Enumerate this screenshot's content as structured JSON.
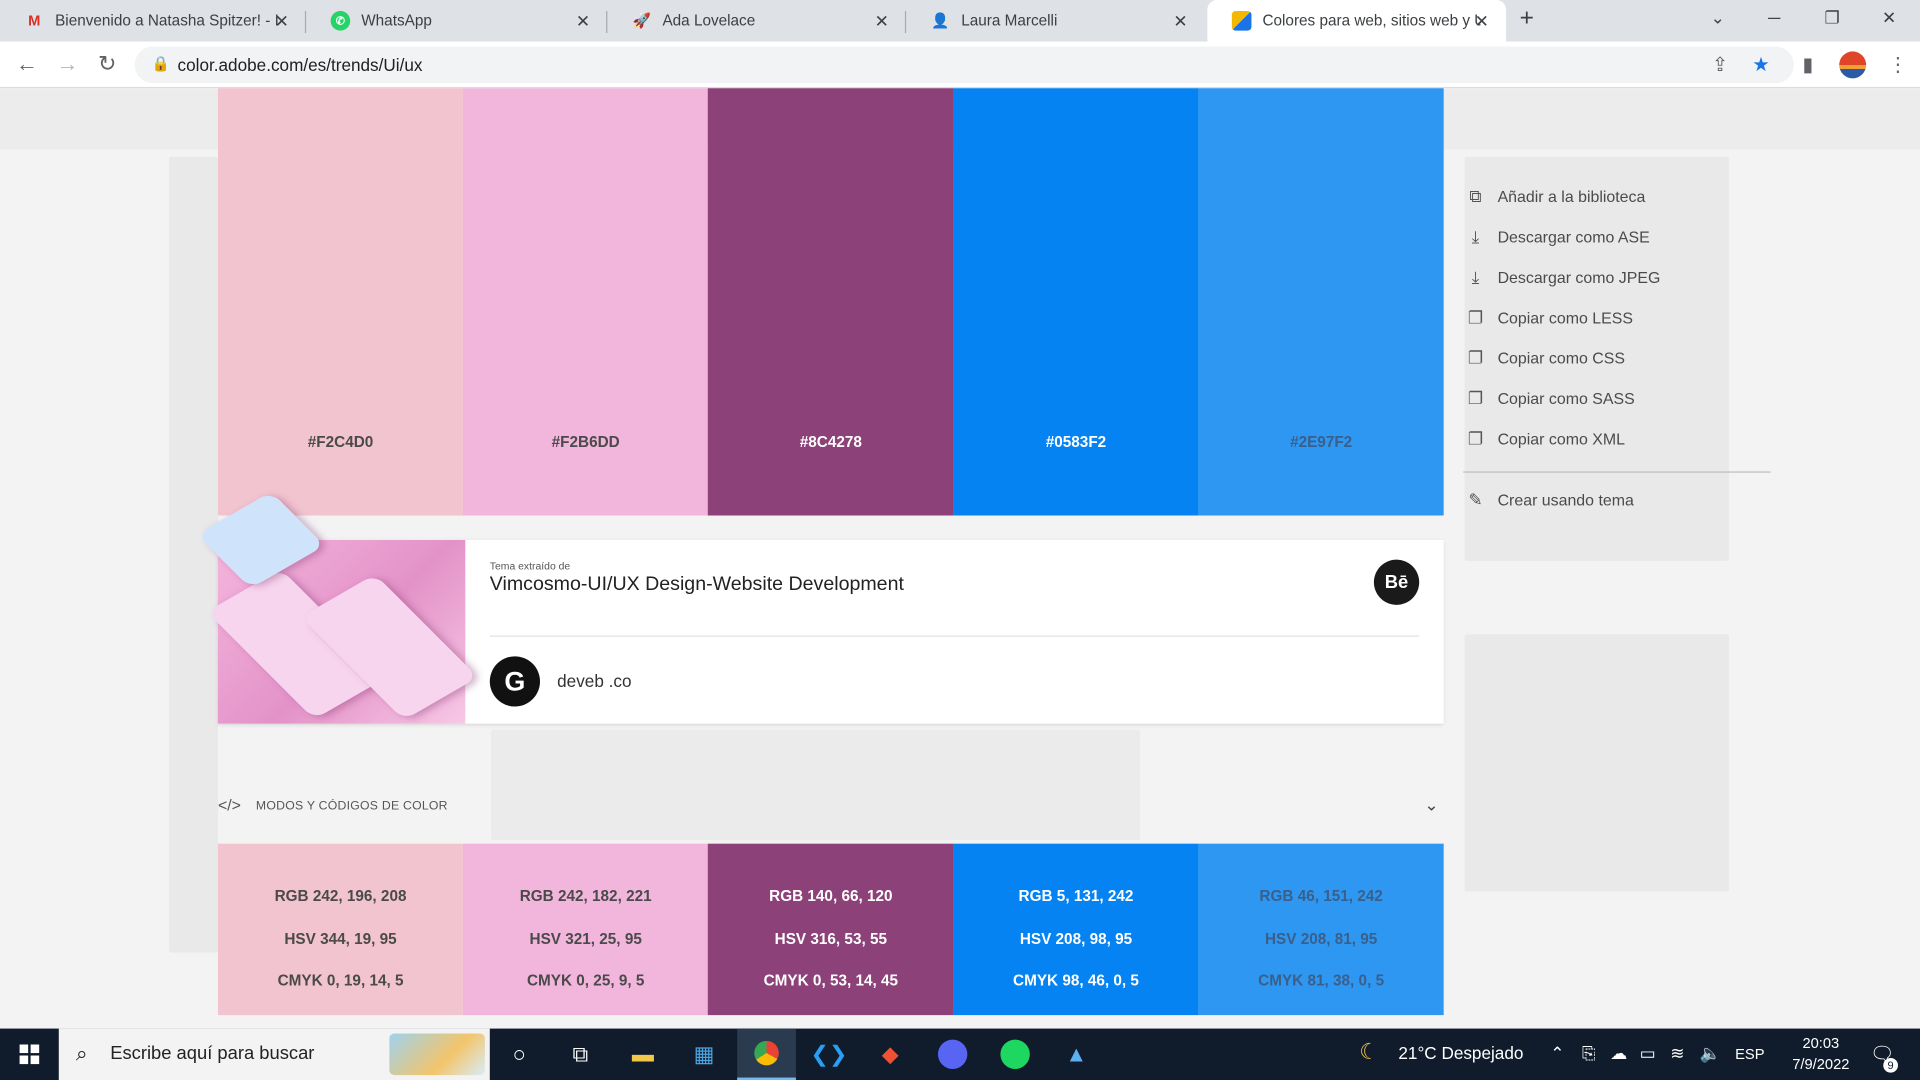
{
  "browser": {
    "tabs": [
      {
        "title": "Bienvenido a Natasha Spitzer! - I",
        "icon": "gmail-icon",
        "active": false
      },
      {
        "title": "WhatsApp",
        "icon": "whatsapp-icon",
        "active": false
      },
      {
        "title": "Ada Lovelace",
        "icon": "rocket-icon",
        "active": false
      },
      {
        "title": "Laura Marcelli",
        "icon": "profile-icon",
        "active": false
      },
      {
        "title": "Colores para web, sitios web y UI",
        "icon": "adobe-color-icon",
        "active": true
      }
    ],
    "url": "color.adobe.com/es/trends/Ui/ux"
  },
  "palette": {
    "swatches": [
      {
        "hex": "#F2C4D0",
        "color": "#F2C4D0",
        "text_color": "#4a4a4a"
      },
      {
        "hex": "#F2B6DD",
        "color": "#F2B6DD",
        "text_color": "#4a4a4a"
      },
      {
        "hex": "#8C4278",
        "color": "#8C4278",
        "text_color": "#ffffff"
      },
      {
        "hex": "#0583F2",
        "color": "#0583F2",
        "text_color": "#ffffff"
      },
      {
        "hex": "#2E97F2",
        "color": "#2E97F2",
        "text_color": "#3a5f8a"
      }
    ]
  },
  "actions_menu": {
    "items": [
      {
        "label": "Añadir a la biblioteca",
        "icon": "library-icon"
      },
      {
        "label": "Descargar como ASE",
        "icon": "download-icon"
      },
      {
        "label": "Descargar como JPEG",
        "icon": "download-icon"
      },
      {
        "label": "Copiar como LESS",
        "icon": "copy-icon"
      },
      {
        "label": "Copiar como CSS",
        "icon": "copy-icon"
      },
      {
        "label": "Copiar como SASS",
        "icon": "copy-icon"
      },
      {
        "label": "Copiar como XML",
        "icon": "copy-icon"
      }
    ],
    "create_label": "Crear usando tema"
  },
  "source_card": {
    "extracted_label": "Tema extraído de",
    "title": "Vimcosmo-UI/UX Design-Website Development",
    "author": "deveb .co",
    "behance_label": "Bē"
  },
  "color_modes": {
    "section_label": "MODOS Y CÓDIGOS DE COLOR",
    "codes": [
      {
        "rgb": "RGB 242, 196, 208",
        "hsv": "HSV 344, 19, 95",
        "cmyk": "CMYK 0, 19, 14, 5"
      },
      {
        "rgb": "RGB 242, 182, 221",
        "hsv": "HSV 321, 25, 95",
        "cmyk": "CMYK 0, 25, 9, 5"
      },
      {
        "rgb": "RGB 140, 66, 120",
        "hsv": "HSV 316, 53, 55",
        "cmyk": "CMYK 0, 53, 14, 45"
      },
      {
        "rgb": "RGB 5, 131, 242",
        "hsv": "HSV 208, 98, 95",
        "cmyk": "CMYK 98, 46, 0, 5"
      },
      {
        "rgb": "RGB 46, 151, 242",
        "hsv": "HSV 208, 81, 95",
        "cmyk": "CMYK 81, 38, 0, 5"
      }
    ]
  },
  "taskbar": {
    "search_placeholder": "Escribe aquí para buscar",
    "weather": "21°C  Despejado",
    "language": "ESP",
    "time": "20:03",
    "date": "7/9/2022",
    "notification_count": "9"
  }
}
